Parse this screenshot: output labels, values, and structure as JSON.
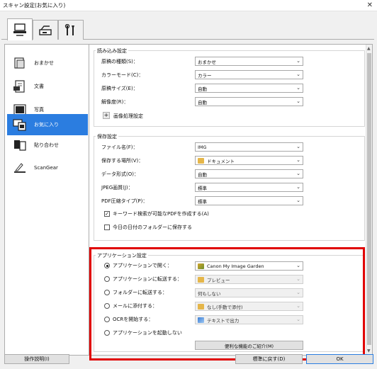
{
  "window": {
    "title": "スキャン設定(お気に入り)",
    "close_glyph": "✕"
  },
  "tabs": [
    {
      "name": "scan-from-computer-tab-icon",
      "active": true
    },
    {
      "name": "scan-from-panel-tab-icon",
      "active": false
    },
    {
      "name": "general-settings-tab-icon",
      "active": false
    }
  ],
  "sidebar": {
    "items": [
      {
        "label": "おまかせ",
        "icon": "auto-scan-icon"
      },
      {
        "label": "文書",
        "icon": "document-icon"
      },
      {
        "label": "写真",
        "icon": "photo-icon"
      },
      {
        "label": "お気に入り",
        "icon": "favorite-icon",
        "active": true
      },
      {
        "label": "貼り合わせ",
        "icon": "stitch-icon"
      },
      {
        "label": "ScanGear",
        "icon": "scangear-icon"
      }
    ]
  },
  "scan_options": {
    "title": "読み込み設定",
    "rows": [
      {
        "label": "原稿の種類(S)：",
        "value": "おまかせ"
      },
      {
        "label": "カラーモード(C)：",
        "value": "カラー"
      },
      {
        "label": "原稿サイズ(E)：",
        "value": "自動"
      },
      {
        "label": "解像度(R)：",
        "value": "自動"
      }
    ],
    "image_processing_label": "画像処理設定"
  },
  "save_settings": {
    "title": "保存設定",
    "filename_label": "ファイル名(F)：",
    "filename_value": "IMG",
    "save_in_label": "保存する場所(V)：",
    "save_in_value": "ドキュメント",
    "data_format_label": "データ形式(O)：",
    "data_format_value": "自動",
    "jpeg_quality_label": "JPEG画質(J)：",
    "jpeg_quality_value": "標準",
    "pdf_compression_label": "PDF圧縮タイプ(P)：",
    "pdf_compression_value": "標準",
    "keyword_pdf_label": "キーワード検索が可能なPDFを作成する(A)",
    "keyword_pdf_checked": true,
    "date_folder_label": "今日の日付のフォルダーに保存する",
    "date_folder_checked": false
  },
  "app_settings": {
    "title": "アプリケーション設定",
    "options": [
      {
        "label": "アプリケーションで開く：",
        "value": "Canon My Image Garden",
        "selected": true,
        "icon": "image-garden-icon"
      },
      {
        "label": "アプリケーションに転送する：",
        "value": "プレビュー",
        "selected": false,
        "icon": "folder-icon"
      },
      {
        "label": "フォルダーに転送する：",
        "value": "何もしない",
        "selected": false,
        "icon": ""
      },
      {
        "label": "メールに添付する：",
        "value": "なし(手動で添付)",
        "selected": false,
        "icon": "folder-icon"
      },
      {
        "label": "OCRを開始する：",
        "value": "テキストで出力",
        "selected": false,
        "icon": "ocr-icon"
      }
    ],
    "no_app_label": "アプリケーションを起動しない",
    "convenient_button": "便利な機能のご紹介(M)"
  },
  "footer": {
    "instructions": "操作説明(I)",
    "defaults": "標準に戻す(D)",
    "ok": "OK"
  },
  "colors": {
    "accent": "#2b7de0",
    "highlight": "#e00000"
  }
}
